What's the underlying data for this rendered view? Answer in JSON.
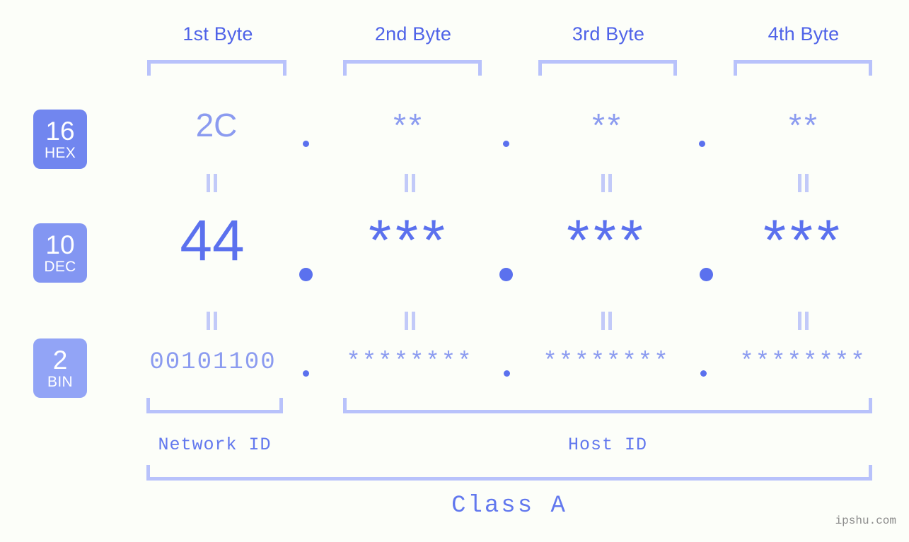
{
  "columns": [
    {
      "label": "1st Byte"
    },
    {
      "label": "2nd Byte"
    },
    {
      "label": "3rd Byte"
    },
    {
      "label": "4th Byte"
    }
  ],
  "bases": [
    {
      "num": "16",
      "unit": "HEX",
      "color": "#7186ef"
    },
    {
      "num": "10",
      "unit": "DEC",
      "color": "#8396f2"
    },
    {
      "num": "2",
      "unit": "BIN",
      "color": "#92a4f6"
    }
  ],
  "rows": {
    "hex": {
      "values": [
        "2C",
        "**",
        "**",
        "**"
      ]
    },
    "dec": {
      "values": [
        "44",
        "***",
        "***",
        "***"
      ]
    },
    "bin": {
      "values": [
        "00101100",
        "********",
        "********",
        "********"
      ]
    }
  },
  "separators": {
    "glyph": "."
  },
  "connectors": {
    "glyph": "="
  },
  "segments": {
    "network_id": "Network ID",
    "host_id": "Host ID",
    "class": "Class A"
  },
  "watermark": "ipshu.com",
  "colors": {
    "background": "#fcfef9",
    "bracket": "#b8c2fb",
    "header_text": "#4f63e8",
    "strong_blue": "#5b71ee",
    "light_blue": "#8b9bf0",
    "connector": "#c2caf9",
    "label_blue": "#6278ee",
    "watermark_gray": "#8a8a8a"
  }
}
